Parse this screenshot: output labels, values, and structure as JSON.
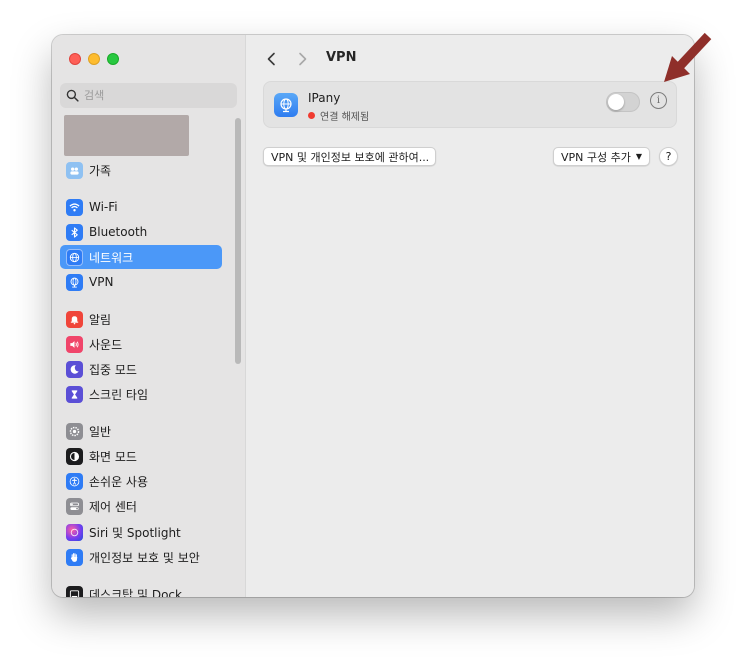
{
  "window": {
    "title": "VPN"
  },
  "sidebar": {
    "search_placeholder": "검색",
    "items": [
      {
        "id": "family",
        "label": "가족",
        "icon": "family-icon",
        "color": "#8fc1f2"
      },
      {
        "id": "wifi",
        "label": "Wi-Fi",
        "icon": "wifi-icon",
        "color": "#2f7cf5"
      },
      {
        "id": "bluetooth",
        "label": "Bluetooth",
        "icon": "bluetooth-icon",
        "color": "#2f7cf5"
      },
      {
        "id": "network",
        "label": "네트워크",
        "icon": "globe-icon",
        "color": "#2f7cf5",
        "selected": true
      },
      {
        "id": "vpn",
        "label": "VPN",
        "icon": "vpn-globe-icon",
        "color": "#2f7cf5"
      },
      {
        "id": "notifications",
        "label": "알림",
        "icon": "bell-icon",
        "color": "#f0453a"
      },
      {
        "id": "sound",
        "label": "사운드",
        "icon": "speaker-icon",
        "color": "#f0456a"
      },
      {
        "id": "focus",
        "label": "집중 모드",
        "icon": "moon-icon",
        "color": "#5b4fd6"
      },
      {
        "id": "screentime",
        "label": "스크린 타임",
        "icon": "hourglass-icon",
        "color": "#5b4fd6"
      },
      {
        "id": "general",
        "label": "일반",
        "icon": "gear-icon",
        "color": "#8e8e93"
      },
      {
        "id": "appearance",
        "label": "화면 모드",
        "icon": "appearance-icon",
        "color": "#1c1c1e"
      },
      {
        "id": "accessibility",
        "label": "손쉬운 사용",
        "icon": "accessibility-icon",
        "color": "#2f7cf5"
      },
      {
        "id": "control",
        "label": "제어 센터",
        "icon": "switches-icon",
        "color": "#8e8e93"
      },
      {
        "id": "siri",
        "label": "Siri 및 Spotlight",
        "icon": "siri-icon",
        "color": "#9b3fd6"
      },
      {
        "id": "privacy",
        "label": "개인정보 보호 및 보안",
        "icon": "hand-icon",
        "color": "#2f7cf5"
      },
      {
        "id": "desktop",
        "label": "데스크탑 및 Dock",
        "icon": "dock-icon",
        "color": "#1c1c1e"
      }
    ]
  },
  "main": {
    "title": "VPN",
    "vpn": {
      "name": "IPany",
      "status": "연결 해제됨",
      "status_color": "#f03b30",
      "enabled": false
    },
    "privacy_button": "VPN 및 개인정보 보호에 관하여...",
    "add_button": "VPN 구성 추가",
    "help_label": "?",
    "info_label": "i"
  },
  "annotation": {
    "color": "#8f2f2a"
  }
}
